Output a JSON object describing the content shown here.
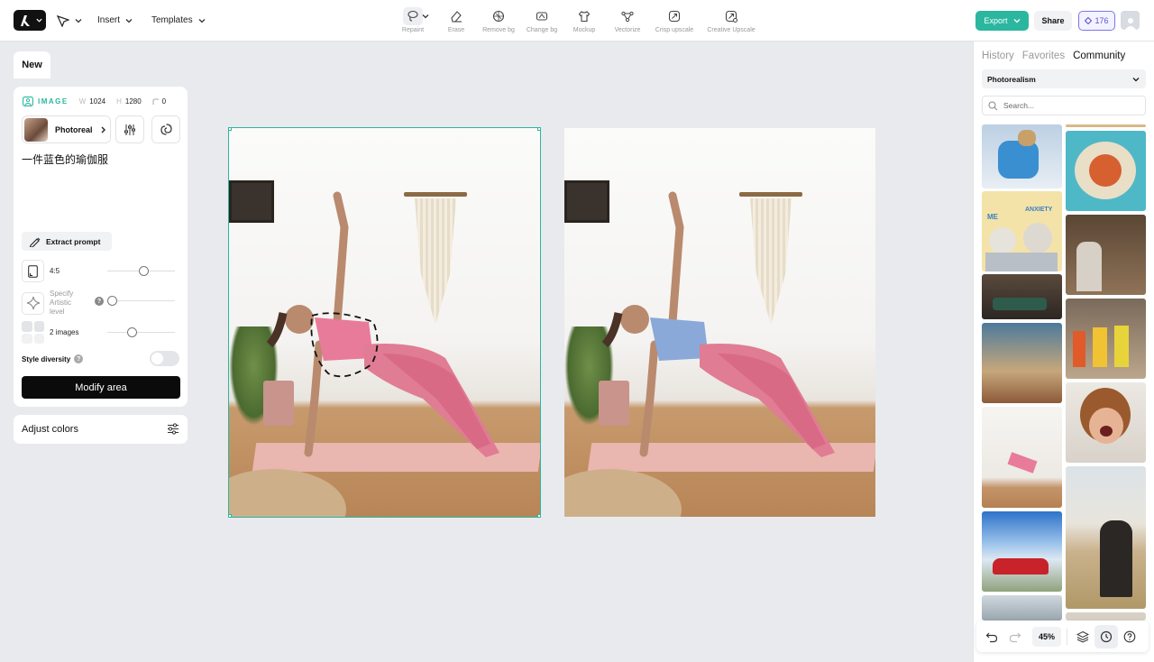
{
  "topbar": {
    "insert_label": "Insert",
    "templates_label": "Templates",
    "tools": [
      {
        "label": "Repaint",
        "icon": "lasso-icon"
      },
      {
        "label": "Erase",
        "icon": "eraser-icon"
      },
      {
        "label": "Remove bg",
        "icon": "remove-bg-icon"
      },
      {
        "label": "Change bg",
        "icon": "change-bg-icon"
      },
      {
        "label": "Mockup",
        "icon": "tshirt-icon"
      },
      {
        "label": "Vectorize",
        "icon": "vector-nodes-icon"
      },
      {
        "label": "Crisp upscale",
        "icon": "upscale-icon"
      },
      {
        "label": "Creative Upscale",
        "icon": "creative-upscale-icon"
      }
    ],
    "export_label": "Export",
    "share_label": "Share",
    "credits": "176",
    "accent_color": "#2bb79f"
  },
  "left_panel": {
    "new_tab": "New",
    "meta": {
      "type_label": "IMAGE",
      "width_key": "W",
      "width_value": "1024",
      "height_key": "H",
      "height_value": "1280",
      "corner_value": "0"
    },
    "style_name": "Photoreal",
    "prompt": "一件蓝色的瑜伽服",
    "extract_prompt_label": "Extract prompt",
    "aspect_ratio": "4:5",
    "artistic_level_label": "Specify Artistic level",
    "images_count_label": "2 images",
    "style_diversity_label": "Style diversity",
    "style_diversity_on": false,
    "modify_button": "Modify area",
    "adjust_colors_label": "Adjust colors"
  },
  "right_panel": {
    "tabs": [
      "History",
      "Favorites",
      "Community"
    ],
    "active_tab": "Community",
    "style_filter": "Photorealism",
    "search_placeholder": "Search...",
    "gallery": [
      {
        "subject": "dog-in-snow"
      },
      {
        "subject": "pizza-island"
      },
      {
        "subject": "opossums-anxiety"
      },
      {
        "subject": "statue-with-laptop"
      },
      {
        "subject": "vintage-car-street"
      },
      {
        "subject": "kids-halloween-costumes"
      },
      {
        "subject": "outdoor-cafe-painting"
      },
      {
        "subject": "screaming-boy"
      },
      {
        "subject": "yoga-pose"
      },
      {
        "subject": "red-convertible"
      },
      {
        "subject": "woman-with-cat-beach"
      },
      {
        "subject": "street-scene"
      }
    ],
    "gallery_text": {
      "anxiety": "ANXIETY",
      "me": "ME"
    }
  },
  "bottom_bar": {
    "zoom": "45%"
  }
}
